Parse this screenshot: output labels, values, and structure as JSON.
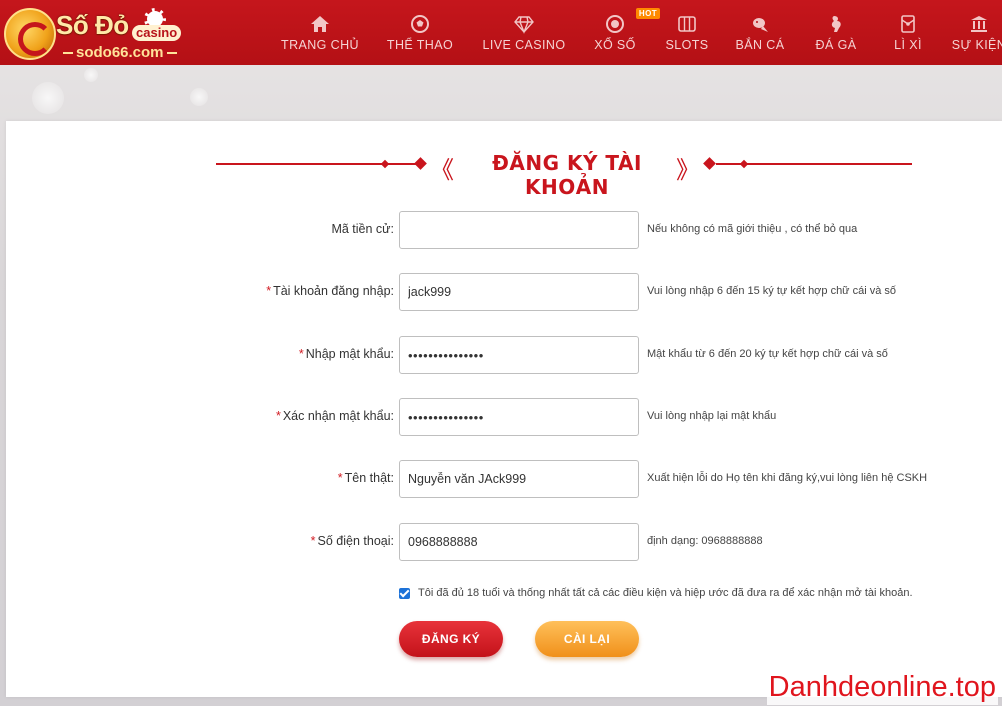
{
  "brand": {
    "name": "Số Đỏ",
    "casino": "casino",
    "site": "sodo66.com"
  },
  "nav": [
    {
      "label": "TRANG CHỦ",
      "icon": "home-icon"
    },
    {
      "label": "THỂ THAO",
      "icon": "soccer-ball-icon"
    },
    {
      "label": "LIVE CASINO",
      "icon": "diamond-icon"
    },
    {
      "label": "XỔ SỐ",
      "icon": "lottery-ball-icon",
      "badge": "HOT"
    },
    {
      "label": "SLOTS",
      "icon": "slot-machine-icon"
    },
    {
      "label": "BẮN CÁ",
      "icon": "fish-icon"
    },
    {
      "label": "ĐÁ GÀ",
      "icon": "rooster-icon"
    },
    {
      "label": "LÌ XÌ",
      "icon": "red-envelope-icon"
    },
    {
      "label": "SỰ KIỆN",
      "icon": "event-building-icon"
    }
  ],
  "form": {
    "title": "ĐĂNG KÝ TÀI KHOẢN",
    "left_bracket": "《",
    "right_bracket": "》",
    "fields": [
      {
        "label": "Mã tiền cử:",
        "required": false,
        "value": "",
        "hint": "Nếu không có mã giới thiệu , có thể bỏ qua"
      },
      {
        "label": "Tài khoản đăng nhập:",
        "required": true,
        "value": "jack999",
        "hint": "Vui lòng nhập 6 đến 15 ký tự kết hợp chữ cái và số"
      },
      {
        "label": "Nhập mật khẩu:",
        "required": true,
        "value": "•••••••••••••••",
        "hint": "Mật khẩu từ 6 đến 20 ký tự kết hợp chữ cái và số"
      },
      {
        "label": "Xác nhận mật khẩu:",
        "required": true,
        "value": "•••••••••••••••",
        "hint": "Vui lòng nhập lại mật khẩu"
      },
      {
        "label": "Tên thật:",
        "required": true,
        "value": "Nguyễn văn JAck999",
        "hint": "Xuất hiện lỗi do Họ tên khi đăng ký,vui lòng liên hệ CSKH"
      },
      {
        "label": "Số điện thoại:",
        "required": true,
        "value": "0968888888",
        "hint": "định dạng: 0968888888"
      }
    ],
    "required_mark": "*",
    "agreement": "Tôi đã đủ 18 tuổi và thống nhất tất cả các điều kiện và hiệp ước đã đưa ra để xác nhận mở tài khoản.",
    "agreement_checked": true,
    "register_label": "ĐĂNG KÝ",
    "reset_label": "CÀI LẠI"
  },
  "watermark": "Danhdeonline.top",
  "colors": {
    "header": "#c5161c",
    "accent_red": "#c9151d",
    "reset_orange": "#f0901a",
    "checkbox": "#1d72d8"
  }
}
